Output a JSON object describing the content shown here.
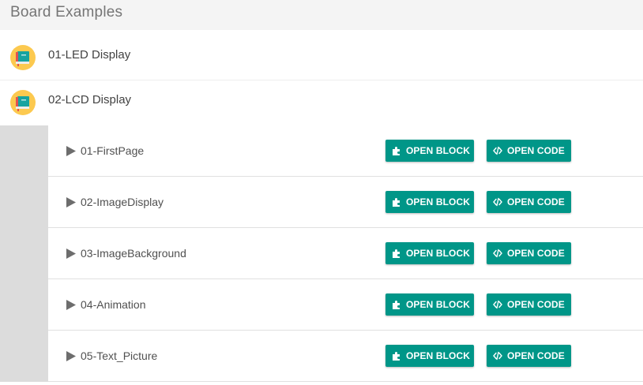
{
  "header": {
    "title": "Board Examples"
  },
  "categories": [
    {
      "label": "01-LED Display",
      "icon": "book-icon"
    },
    {
      "label": "02-LCD Display",
      "icon": "book-icon"
    }
  ],
  "examples": [
    {
      "name": "01-FirstPage"
    },
    {
      "name": "02-ImageDisplay"
    },
    {
      "name": "03-ImageBackground"
    },
    {
      "name": "04-Animation"
    },
    {
      "name": "05-Text_Picture"
    }
  ],
  "buttons": {
    "open_block": "OPEN BLOCK",
    "open_code": "OPEN CODE",
    "open_block_icon": "puzzle-icon",
    "open_code_icon": "code-icon"
  },
  "colors": {
    "accent": "#009688",
    "rail": "#dcdcdc",
    "header_bg": "#f4f4f4"
  }
}
